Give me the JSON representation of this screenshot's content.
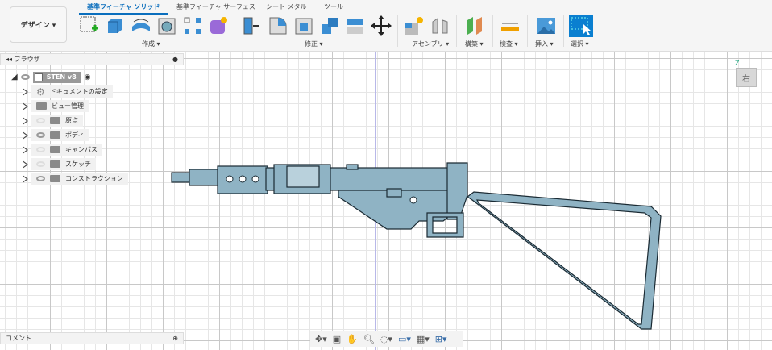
{
  "toolbar": {
    "workspace": "デザイン ▾",
    "tabs": [
      "基準フィーチャ ソリッド",
      "基準フィーチャ サーフェス",
      "シート メタル",
      "ツール"
    ],
    "groups": [
      "作成 ▾",
      "修正 ▾",
      "アセンブリ ▾",
      "構築 ▾",
      "検査 ▾",
      "挿入 ▾",
      "選択 ▾"
    ]
  },
  "browser": {
    "title": "ブラウザ",
    "root": "STEN v8",
    "items": [
      {
        "label": "ドキュメントの設定",
        "icon": "gear"
      },
      {
        "label": "ビュー管理",
        "icon": "folder"
      },
      {
        "label": "原点",
        "visible": false
      },
      {
        "label": "ボディ",
        "visible": true
      },
      {
        "label": "キャンバス",
        "visible": false
      },
      {
        "label": "スケッチ",
        "visible": false
      },
      {
        "label": "コンストラクション",
        "visible": true
      }
    ]
  },
  "comments": {
    "title": "コメント"
  },
  "viewcube": {
    "face": "右",
    "axis": "Z"
  },
  "colors": {
    "accent": "#0a6ebd",
    "model": "#8fb3c4",
    "outline": "#1a2a33"
  }
}
